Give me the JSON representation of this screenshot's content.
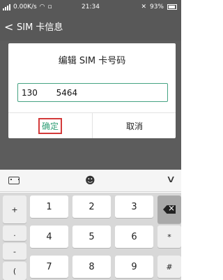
{
  "status_bar": {
    "network_speed": "0.00K/s",
    "time": "21:34",
    "battery": "93%"
  },
  "title_bar": {
    "back_symbol": "<",
    "title": "SIM 卡信息"
  },
  "dialog": {
    "title": "编辑 SIM 卡号码",
    "input_value": "130       5464",
    "ok_label": "确定",
    "cancel_label": "取消"
  },
  "keyboard": {
    "toolbar_icons": [
      "keyboard-icon",
      "emoji-icon",
      "chevron-down-icon"
    ],
    "left_keys": [
      "+",
      ".",
      "-",
      "("
    ],
    "digit_keys": [
      "1",
      "2",
      "3",
      "4",
      "5",
      "6",
      "7",
      "8",
      "9"
    ],
    "right_keys": [
      "backspace-icon",
      "*",
      "#"
    ]
  }
}
